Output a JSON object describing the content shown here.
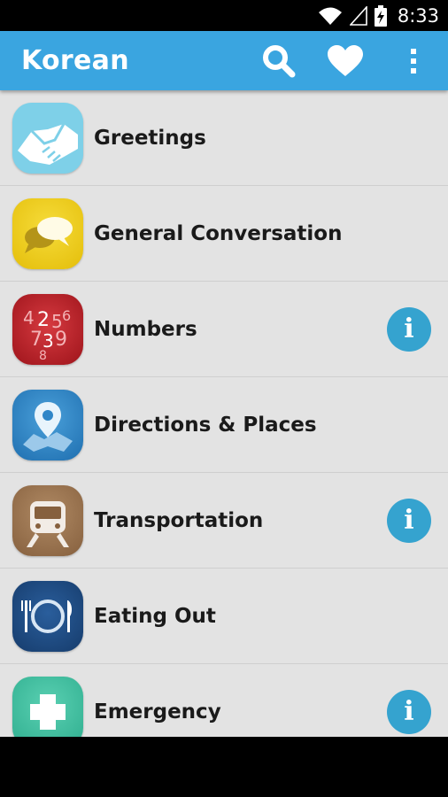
{
  "status": {
    "time": "8:33"
  },
  "app_bar": {
    "title": "Korean"
  },
  "categories": [
    {
      "label": "Greetings",
      "icon": "handshake-icon",
      "color": "#7fd2e8",
      "info": false
    },
    {
      "label": "General Conversation",
      "icon": "speech-bubbles-icon",
      "color": "#f1cf1a",
      "info": false
    },
    {
      "label": "Numbers",
      "icon": "numbers-icon",
      "color": "#c8232b",
      "info": true
    },
    {
      "label": "Directions & Places",
      "icon": "map-pin-icon",
      "color": "#2f86c8",
      "info": false
    },
    {
      "label": "Transportation",
      "icon": "train-icon",
      "color": "#9b7351",
      "info": true
    },
    {
      "label": "Eating Out",
      "icon": "plate-cutlery-icon",
      "color": "#1e4d86",
      "info": false
    },
    {
      "label": "Emergency",
      "icon": "medical-cross-icon",
      "color": "#45c3a4",
      "info": true
    }
  ],
  "info_glyph": "i",
  "colors": {
    "app_bar": "#3aa5e0",
    "list_bg": "#e3e3e3",
    "info_button": "#35a3cf"
  }
}
